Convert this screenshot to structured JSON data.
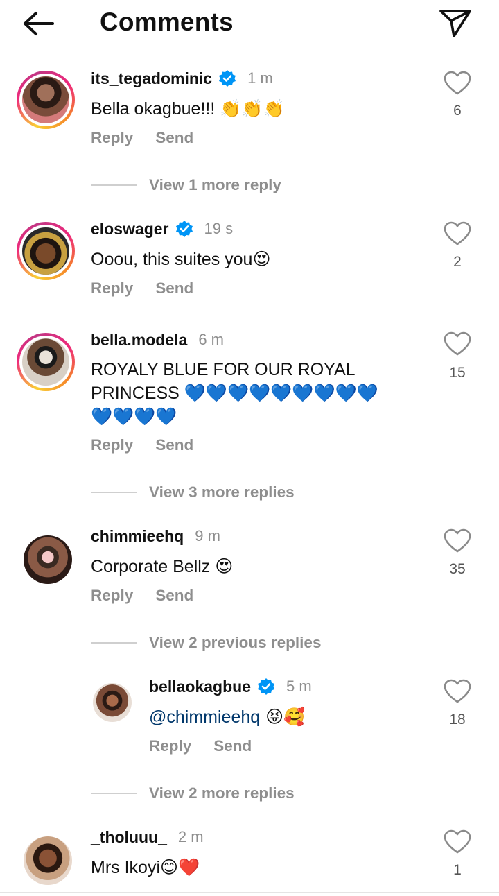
{
  "header": {
    "title": "Comments",
    "back_icon": "arrow-left-icon",
    "send_icon": "paper-plane-icon"
  },
  "actions": {
    "reply": "Reply",
    "send": "Send"
  },
  "comments": [
    {
      "username": "its_tegadominic",
      "verified": true,
      "time": "1 m",
      "text": "Bella okagbue!!! ",
      "emoji": "👏👏👏",
      "likes": "6"
    },
    {
      "username": "eloswager",
      "verified": true,
      "time": "19 s",
      "text": "Ooou, this suites you",
      "emoji": "😍",
      "likes": "2"
    },
    {
      "username": "bella.modela",
      "verified": false,
      "time": "6 m",
      "text_line1": "ROYALY BLUE FOR OUR ROYAL",
      "text_line2": "PRINCESS ",
      "emoji_line2": "💙💙💙💙💙💙💙💙💙",
      "emoji_line3": "💙💙💙💙",
      "likes": "15"
    },
    {
      "username": "chimmieehq",
      "verified": false,
      "time": "9 m",
      "text": "Corporate Bellz ",
      "emoji": "😍",
      "likes": "35"
    },
    {
      "username": "bellaokagbue",
      "verified": true,
      "time": "5 m",
      "mention": "@chimmieehq",
      "emoji": " 😝🥰",
      "likes": "18"
    },
    {
      "username": "_tholuuu_",
      "verified": false,
      "time": "2 m",
      "text": "Mrs Ikoyi",
      "emoji": "😊❤️",
      "likes": "1"
    }
  ],
  "view_more": {
    "c0": "View 1 more reply",
    "c2": "View 3 more replies",
    "c3_prev": "View 2 previous replies",
    "c3_more": "View 2 more replies"
  },
  "colors": {
    "verified": "#0095f6",
    "secondary": "#8e8e8e",
    "mention": "#00376b"
  }
}
